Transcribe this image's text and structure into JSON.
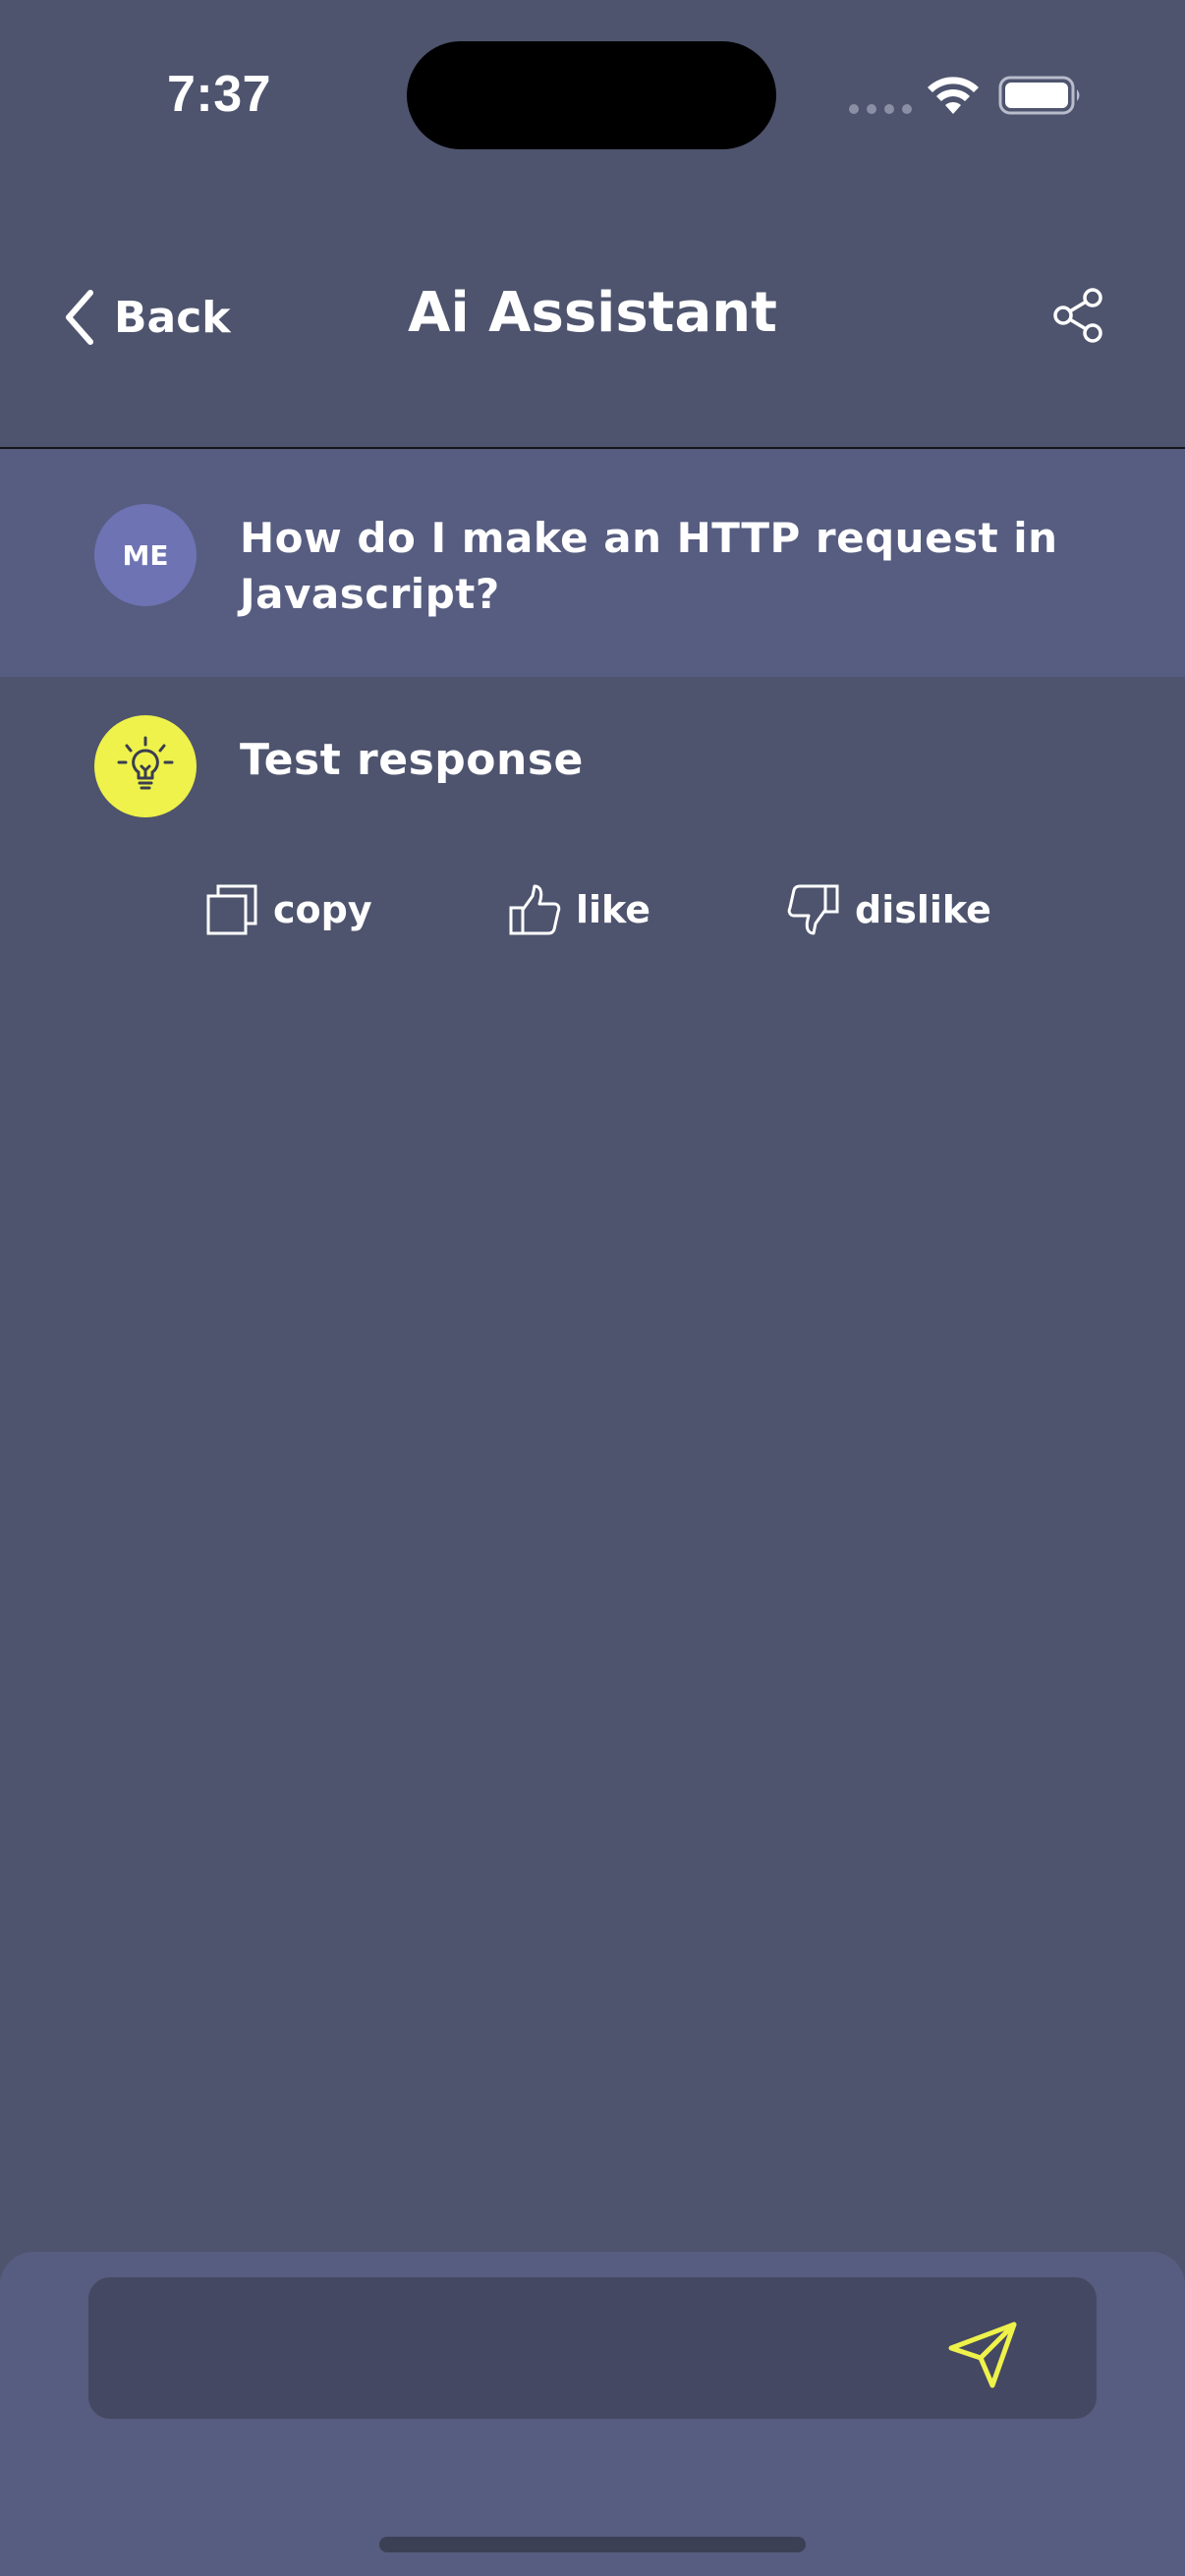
{
  "status_bar": {
    "time": "7:37",
    "icons": [
      "cellular-signal-icon",
      "wifi-icon",
      "battery-icon"
    ]
  },
  "header": {
    "back_label": "Back",
    "title": "Ai Assistant",
    "share_icon": "share-icon"
  },
  "conversation": {
    "user_avatar": "ME",
    "user_message": "How do I make an HTTP request in Javascript?",
    "ai_avatar_icon": "lightbulb-icon",
    "ai_response": "Test response",
    "actions": {
      "copy": "copy",
      "like": "like",
      "dislike": "dislike"
    }
  },
  "composer": {
    "value": "",
    "placeholder": "",
    "send_icon": "send-icon"
  },
  "colors": {
    "background": "#4e546e",
    "user_row": "#575d80",
    "me_avatar": "#6e73b4",
    "ai_avatar": "#eef24a",
    "accent": "#eef24a",
    "input": "#444862"
  }
}
